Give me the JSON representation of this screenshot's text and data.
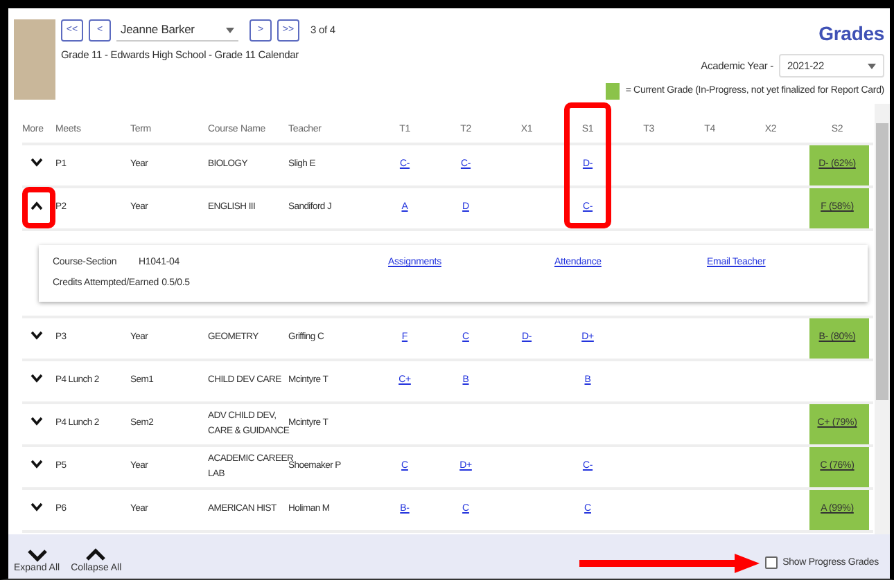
{
  "student": {
    "first_button": "<<",
    "prev_button": "<",
    "name": "Jeanne Barker",
    "next_button": ">",
    "last_button": ">>",
    "position": "3 of 4",
    "subtitle": "Grade 11 - Edwards High School - Grade 11 Calendar"
  },
  "page_title": "Grades",
  "academic_year": {
    "label": "Academic Year -",
    "value": "2021-22"
  },
  "legend": "= Current Grade (In-Progress, not yet finalized for Report Card)",
  "columns": [
    {
      "label": "More",
      "highlighted": false
    },
    {
      "label": "Meets",
      "highlighted": false
    },
    {
      "label": "Term",
      "highlighted": false
    },
    {
      "label": "Course Name",
      "highlighted": false
    },
    {
      "label": "Teacher",
      "highlighted": false
    },
    {
      "label": "T1",
      "highlighted": false
    },
    {
      "label": "T2",
      "highlighted": false
    },
    {
      "label": "X1",
      "highlighted": false
    },
    {
      "label": "S1",
      "highlighted": true
    },
    {
      "label": "T3",
      "highlighted": false
    },
    {
      "label": "T4",
      "highlighted": false
    },
    {
      "label": "X2",
      "highlighted": false
    },
    {
      "label": "S2",
      "highlighted": false
    }
  ],
  "rows": [
    {
      "expanded": false,
      "toggle_highlighted": false,
      "meets": "P1",
      "term": "Year",
      "course": "BIOLOGY",
      "teacher": "Sligh E",
      "grades": {
        "t1": {
          "grade": "C-",
          "current": false
        },
        "t2": {
          "grade": "C-",
          "current": false
        },
        "s1": {
          "grade": "D-",
          "current": false
        },
        "s2": {
          "grade": "D- (62%)",
          "current": true
        }
      }
    },
    {
      "expanded": true,
      "toggle_highlighted": true,
      "meets": "P2",
      "term": "Year",
      "course": "ENGLISH III",
      "teacher": "Sandiford J",
      "grades": {
        "t1": {
          "grade": "A",
          "current": false
        },
        "t2": {
          "grade": "D",
          "current": false
        },
        "s1": {
          "grade": "C-",
          "current": false
        },
        "s2": {
          "grade": "F (58%)",
          "current": true
        }
      },
      "details": {
        "section_label": "Course-Section",
        "section": "H1041-04",
        "credits_label": "Credits Attempted/Earned",
        "credits": "0.5/0.5",
        "links": [
          "Assignments",
          "Attendance",
          "Email Teacher"
        ]
      }
    },
    {
      "expanded": false,
      "toggle_highlighted": false,
      "meets": "P3",
      "term": "Year",
      "course": "GEOMETRY",
      "teacher": "Griffing C",
      "grades": {
        "t1": {
          "grade": "F",
          "current": false
        },
        "t2": {
          "grade": "C",
          "current": false
        },
        "x1": {
          "grade": "D-",
          "current": false
        },
        "s1": {
          "grade": "D+",
          "current": false
        },
        "s2": {
          "grade": "B- (80%)",
          "current": true
        }
      }
    },
    {
      "expanded": false,
      "toggle_highlighted": false,
      "meets": "P4 Lunch 2",
      "term": "Sem1",
      "course": "CHILD DEV CARE",
      "teacher": "Mcintyre T",
      "grades": {
        "t1": {
          "grade": "C+",
          "current": false
        },
        "t2": {
          "grade": "B",
          "current": false
        },
        "s1": {
          "grade": "B",
          "current": false
        }
      }
    },
    {
      "expanded": false,
      "toggle_highlighted": false,
      "meets": "P4 Lunch 2",
      "term": "Sem2",
      "course": "ADV CHILD DEV, CARE & GUIDANCE",
      "teacher": "Mcintyre T",
      "grades": {
        "s2": {
          "grade": "C+ (79%)",
          "current": true
        }
      }
    },
    {
      "expanded": false,
      "toggle_highlighted": false,
      "meets": "P5",
      "term": "Year",
      "course": "ACADEMIC CAREER LAB",
      "teacher": "Shoemaker P",
      "grades": {
        "t1": {
          "grade": "C",
          "current": false
        },
        "t2": {
          "grade": "D+",
          "current": false
        },
        "s1": {
          "grade": "C-",
          "current": false
        },
        "s2": {
          "grade": "C (76%)",
          "current": true
        }
      }
    },
    {
      "expanded": false,
      "toggle_highlighted": false,
      "meets": "P6",
      "term": "Year",
      "course": "AMERICAN HIST",
      "teacher": "Holiman M",
      "grades": {
        "t1": {
          "grade": "B-",
          "current": false
        },
        "t2": {
          "grade": "C",
          "current": false
        },
        "s1": {
          "grade": "C",
          "current": false
        },
        "s2": {
          "grade": "A (99%)",
          "current": true
        }
      }
    }
  ],
  "footer": {
    "expand_all": "Expand All",
    "collapse_all": "Collapse All",
    "progress": {
      "label": "Show Progress Grades",
      "checked": false,
      "arrow_pointing": true
    }
  }
}
